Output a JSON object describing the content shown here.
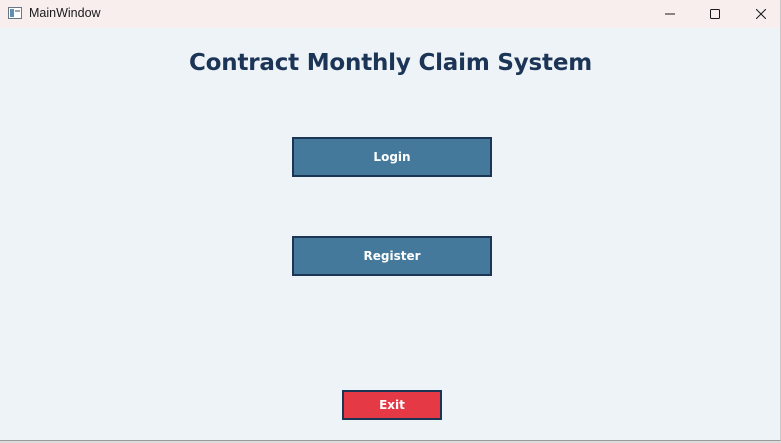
{
  "window": {
    "title": "MainWindow",
    "icon": "app-window-icon",
    "controls": {
      "minimize_icon": "minimize-icon",
      "maximize_icon": "maximize-icon",
      "close_icon": "close-icon"
    }
  },
  "main": {
    "heading": "Contract Monthly Claim System",
    "login_label": "Login",
    "register_label": "Register",
    "exit_label": "Exit"
  },
  "colors": {
    "heading": "#1c3557",
    "primary_button": "#44799c",
    "button_border": "#1b3555",
    "exit_button": "#e63946",
    "background": "#eef3f7",
    "titlebar": "#f8eeee"
  }
}
